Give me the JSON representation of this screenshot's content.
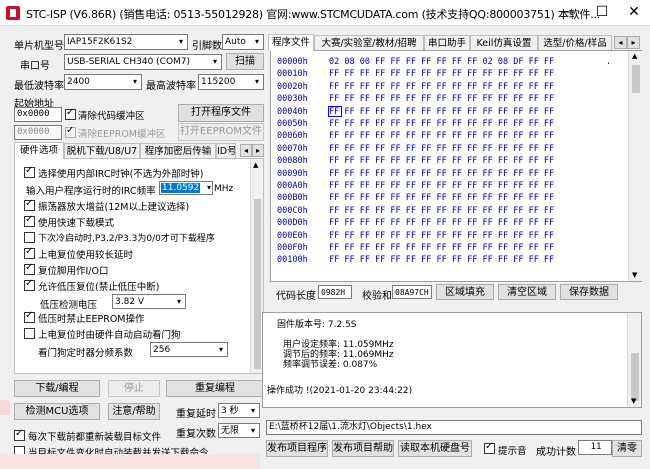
{
  "window": {
    "title": "STC-ISP (V6.86R) (销售电话: 0513-55012928) 官网:www.STCMCUDATA.com  (技术支持QQ:800003751) 本软件...",
    "minimize": "—",
    "maximize": "☐",
    "close": "✕"
  },
  "left": {
    "mcu_label": "单片机型号",
    "mcu_value": "IAP15F2K61S2",
    "pins_label": "引脚数",
    "pins_value": "Auto",
    "port_label": "串口号",
    "port_value": "USB-SERIAL CH340 (COM7)",
    "scan": "扫描",
    "min_baud_label": "最低波特率",
    "min_baud_value": "2400",
    "max_baud_label": "最高波特率",
    "max_baud_value": "115200",
    "start_addr_label": "起始地址",
    "addr1": "0x0000",
    "clear_code": "清除代码缓冲区",
    "open_program": "打开程序文件",
    "addr2": "0x0000",
    "clear_eeprom": "清除EEPROM缓冲区",
    "open_eeprom": "打开EEPROM文件"
  },
  "hw_tabs": [
    "硬件选项",
    "脱机下载/U8/U7",
    "程序加密后传输",
    "ID号"
  ],
  "options": [
    {
      "label": "选择使用内部IRC时钟(不选为外部时钟)",
      "checked": true
    },
    {
      "label": "输入用户程序运行时的IRC频率"
    },
    {
      "label": "振荡器放大增益(12M以上建议选择)",
      "checked": true
    },
    {
      "label": "使用快速下载模式",
      "checked": true
    },
    {
      "label": "下次冷启动时,P3.2/P3.3为0/0才可下载程序",
      "checked": false
    },
    {
      "label": "上电复位使用较长延时",
      "checked": true
    },
    {
      "label": "复位脚用作I/O口",
      "checked": true
    },
    {
      "label": "允许低压复位(禁止低压中断)",
      "checked": true
    },
    {
      "label": "低压检测电压"
    },
    {
      "label": "低压时禁止EEPROM操作",
      "checked": true
    },
    {
      "label": "上电复位时由硬件自动启动看门狗",
      "checked": false
    },
    {
      "label": "看门狗定时器分频系数"
    }
  ],
  "irc_value": "11.0592",
  "irc_unit": "MHz",
  "lvd_value": "3.82 V",
  "wdt_value": "256",
  "buttons": {
    "download": "下载/编程",
    "stop": "停止",
    "reprogram": "重复编程",
    "check_mcu": "检测MCU选项",
    "help": "注意/帮助",
    "repeat_delay_label": "重复延时",
    "repeat_delay_value": "3 秒",
    "repeat_count_label": "重复次数",
    "repeat_count_value": "无限"
  },
  "bottom_left": {
    "reload": "每次下载前都重新装载目标文件",
    "auto_send": "当目标文件变化时自动装载并发送下载命令"
  },
  "right_tabs": [
    "程序文件",
    "大赛/实验室/教材/招聘",
    "串口助手",
    "Keil仿真设置",
    "选型/价格/样品"
  ],
  "hex": {
    "rows": [
      {
        "addr": "00000h",
        "bytes": "02 08 00 FF FF FF FF FF FF FF 02 08 DF FF FF",
        "ascii": ". "
      },
      {
        "addr": "00010h",
        "bytes": "FF FF FF FF FF FF FF FF FF FF FF FF FF FF FF",
        "ascii": ""
      },
      {
        "addr": "00020h",
        "bytes": "FF FF FF FF FF FF FF FF FF FF FF FF FF FF FF",
        "ascii": ""
      },
      {
        "addr": "00030h",
        "bytes": "FF FF FF FF FF FF FF FF FF FF FF FF FF FF FF",
        "ascii": ""
      },
      {
        "addr": "00040h",
        "bytes": "FF FF FF FF FF FF FF FF FF FF FF FF FF FF FF",
        "ascii": ""
      },
      {
        "addr": "00050h",
        "bytes": "FF FF FF FF FF FF FF FF FF FF FF FF FF FF FF",
        "ascii": ""
      },
      {
        "addr": "00060h",
        "bytes": "FF FF FF FF FF FF FF FF FF FF FF FF FF FF FF",
        "ascii": ""
      },
      {
        "addr": "00070h",
        "bytes": "FF FF FF FF FF FF FF FF FF FF FF FF FF FF FF",
        "ascii": ""
      },
      {
        "addr": "00080h",
        "bytes": "FF FF FF FF FF FF FF FF FF FF FF FF FF FF FF",
        "ascii": ""
      },
      {
        "addr": "00090h",
        "bytes": "FF FF FF FF FF FF FF FF FF FF FF FF FF FF FF",
        "ascii": ""
      },
      {
        "addr": "000A0h",
        "bytes": "FF FF FF FF FF FF FF FF FF FF FF FF FF FF FF",
        "ascii": ""
      },
      {
        "addr": "000B0h",
        "bytes": "FF FF FF FF FF FF FF FF FF FF FF FF FF FF FF",
        "ascii": ""
      },
      {
        "addr": "000C0h",
        "bytes": "FF FF FF FF FF FF FF FF FF FF FF FF FF FF FF",
        "ascii": ""
      },
      {
        "addr": "000D0h",
        "bytes": "FF FF FF FF FF FF FF FF FF FF FF FF FF FF FF",
        "ascii": ""
      },
      {
        "addr": "000E0h",
        "bytes": "FF FF FF FF FF FF FF FF FF FF FF FF FF FF FF",
        "ascii": ""
      },
      {
        "addr": "000F0h",
        "bytes": "FF FF FF FF FF FF FF FF FF FF FF FF FF FF FF",
        "ascii": ""
      },
      {
        "addr": "00100h",
        "bytes": "FF FF FF FF FF FF FF FF FF FF FF FF FF FF FF",
        "ascii": ""
      }
    ]
  },
  "code_bar": {
    "code_len_label": "代码长度",
    "code_len": "0982H",
    "checksum_label": "校验和",
    "checksum": "08A97CH",
    "fill": "区域填充",
    "clear": "清空区域",
    "save": "保存数据"
  },
  "log": [
    "固件版本号: 7.2.5S",
    "用户设定频率: 11.059MHz",
    "调节后的频率: 11.069MHz",
    "频率调节误差: 0.087%",
    "操作成功 !(2021-01-20 23:44:22)"
  ],
  "path": "E:\\蓝桥杯12届\\1.流水灯\\Objects\\1.hex",
  "bottom_right": {
    "publish": "发布项目程序",
    "publish_help": "发布项目帮助",
    "read_disk": "读取本机硬盘号",
    "beep": "提示音",
    "success_label": "成功计数",
    "success_count": "11",
    "clear": "清零"
  }
}
